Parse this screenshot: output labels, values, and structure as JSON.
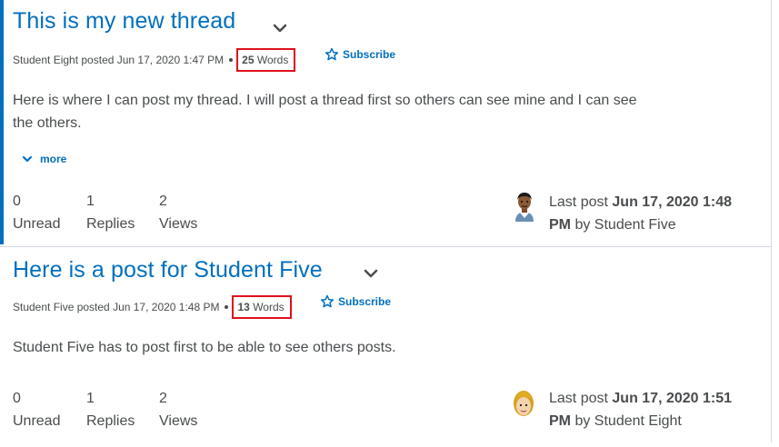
{
  "threads": [
    {
      "title": "This is my new thread",
      "meta_author": "Student Eight posted Jun 17, 2020 1:47 PM",
      "word_count": "25",
      "word_label": "Words",
      "subscribe_label": "Subscribe",
      "body": "Here is where I can post my thread. I will post a thread first so others can see mine and I can see the others.",
      "more_label": "more",
      "unread_count": "0",
      "unread_label": "Unread",
      "replies_count": "1",
      "replies_label": "Replies",
      "views_count": "2",
      "views_label": "Views",
      "last_post_prefix": "Last post",
      "last_post_date": "Jun 17, 2020 1:48 PM",
      "last_post_by": "by Student Five"
    },
    {
      "title": "Here is a post for Student Five",
      "meta_author": "Student Five posted Jun 17, 2020 1:48 PM",
      "word_count": "13",
      "word_label": "Words",
      "subscribe_label": "Subscribe",
      "body": "Student Five has to post first to be able to see others posts.",
      "unread_count": "0",
      "unread_label": "Unread",
      "replies_count": "1",
      "replies_label": "Replies",
      "views_count": "2",
      "views_label": "Views",
      "last_post_prefix": "Last post",
      "last_post_date": "Jun 17, 2020 1:51 PM",
      "last_post_by": "by Student Eight"
    }
  ],
  "colors": {
    "accent": "#006fbf",
    "highlight_box": "#e0101c",
    "text": "#494c4e"
  }
}
